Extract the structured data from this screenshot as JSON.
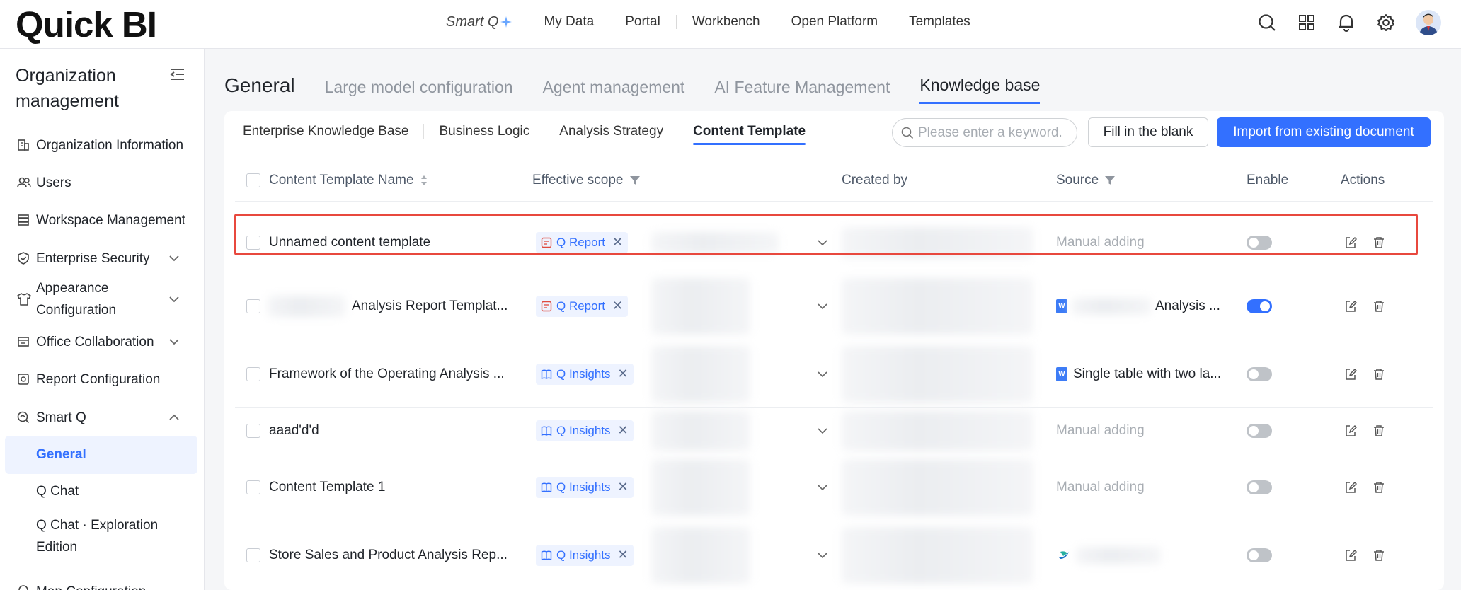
{
  "app": {
    "logo_text": "Quick BI",
    "topnav": {
      "smart_q": "Smart Q",
      "items": [
        "My Data",
        "Portal",
        "Workbench",
        "Open Platform",
        "Templates"
      ]
    }
  },
  "sidebar": {
    "title": "Organization management",
    "items": [
      {
        "label": "Organization Information",
        "icon": "org-info-icon"
      },
      {
        "label": "Users",
        "icon": "users-icon"
      },
      {
        "label": "Workspace Management",
        "icon": "workspace-icon"
      },
      {
        "label": "Enterprise Security",
        "icon": "shield-icon"
      },
      {
        "label": "Appearance Configuration",
        "icon": "shirt-icon"
      },
      {
        "label": "Office Collaboration",
        "icon": "office-icon"
      },
      {
        "label": "Report Configuration",
        "icon": "report-icon"
      },
      {
        "label": "Smart Q",
        "icon": "smartq-icon"
      }
    ],
    "sub_items": [
      "General",
      "Q Chat",
      "Q Chat · Exploration Edition"
    ],
    "partial_item": "Map Configuration"
  },
  "main": {
    "tabs": [
      "General",
      "Large model configuration",
      "Agent management",
      "AI Feature Management",
      "Knowledge base"
    ],
    "active_tab": "Knowledge base",
    "subtabs": [
      "Enterprise Knowledge Base",
      "Business Logic",
      "Analysis Strategy",
      "Content Template"
    ],
    "active_subtab": "Content Template",
    "search_placeholder": "Please enter a keyword.",
    "fill_button": "Fill in the blank",
    "import_button": "Import from existing document"
  },
  "table": {
    "columns": [
      "Content Template Name",
      "Effective scope",
      "Created by",
      "Source",
      "Enable",
      "Actions"
    ],
    "rows": [
      {
        "name": "Unnamed content template",
        "scope": "Q Report",
        "source": "Manual adding",
        "source_type": "manual",
        "enabled": false
      },
      {
        "name": "Analysis Report Templat...",
        "scope": "Q Report",
        "source": "Analysis ...",
        "source_type": "word",
        "enabled": true
      },
      {
        "name": "Framework of the Operating Analysis ...",
        "scope": "Q Insights",
        "source": "Single table with two la...",
        "source_type": "word",
        "enabled": false
      },
      {
        "name": "aaad'd'd",
        "scope": "Q Insights",
        "source": "Manual adding",
        "source_type": "manual",
        "enabled": false
      },
      {
        "name": "Content Template 1",
        "scope": "Q Insights",
        "source": "Manual adding",
        "source_type": "manual",
        "enabled": false
      },
      {
        "name": "Store Sales and Product Analysis Rep...",
        "scope": "Q Insights",
        "source": "",
        "source_type": "brand",
        "enabled": false
      }
    ]
  },
  "colors": {
    "accent": "#3370ff",
    "highlight": "#e8483e"
  }
}
